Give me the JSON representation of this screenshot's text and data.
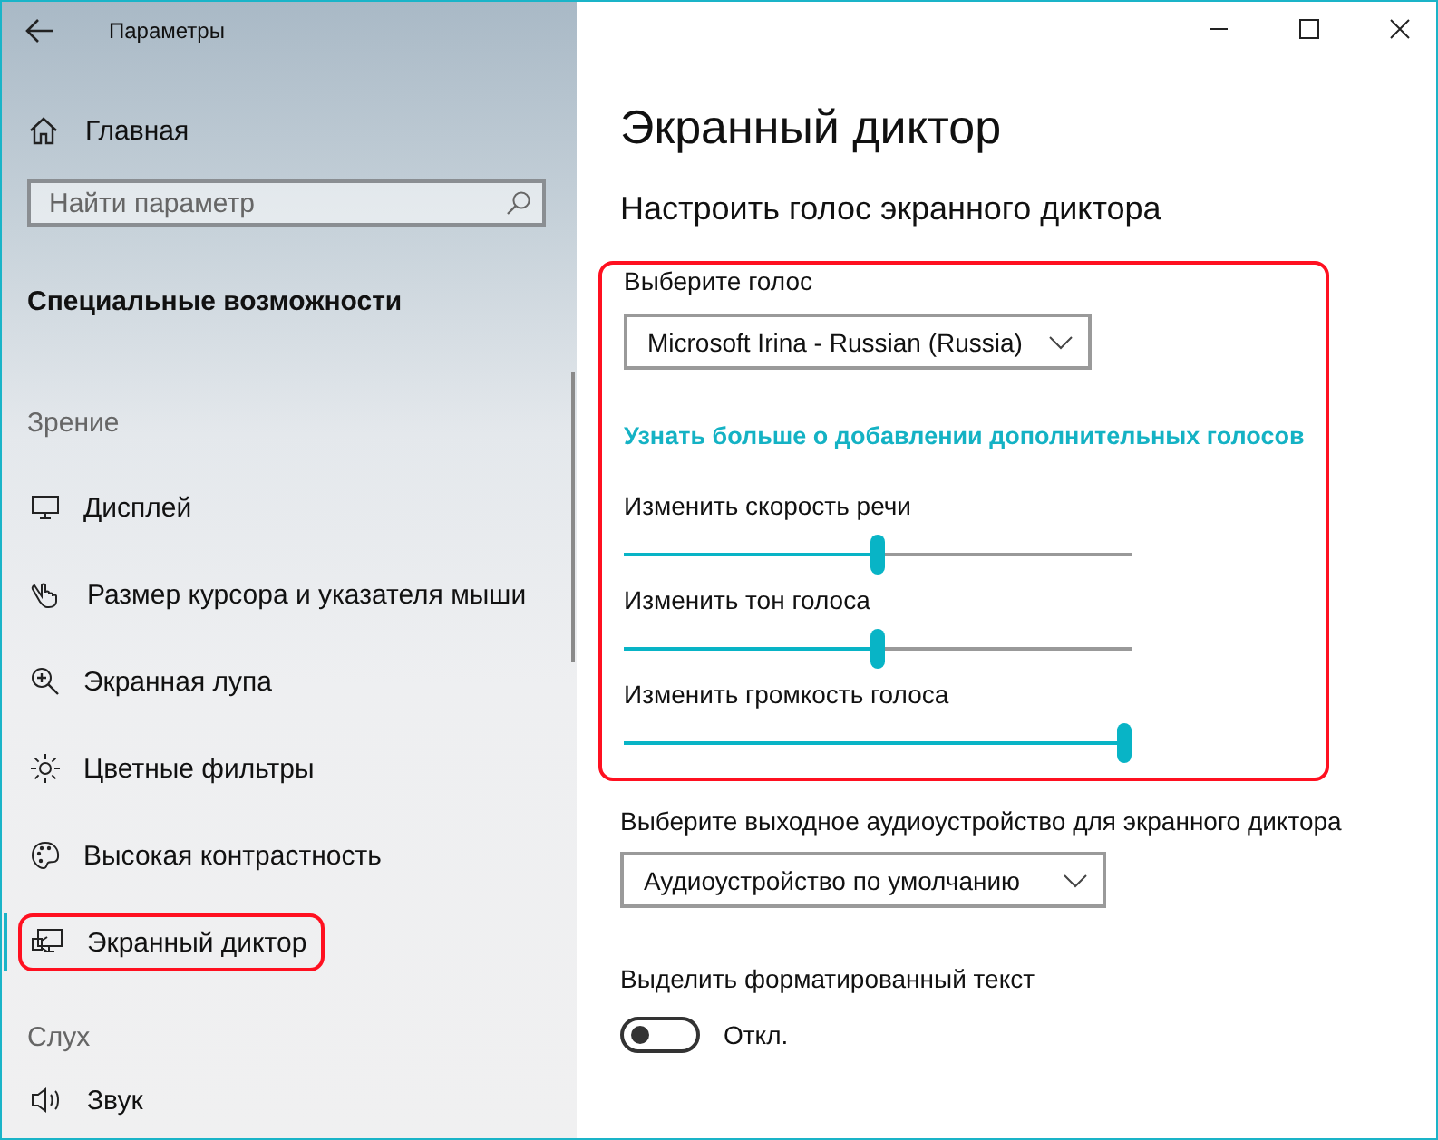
{
  "window": {
    "title": "Параметры"
  },
  "sidebar": {
    "home": "Главная",
    "search": {
      "placeholder": "Найти параметр"
    },
    "section_title": "Специальные возможности",
    "groups": [
      {
        "heading": "Зрение",
        "items": [
          {
            "label": "Дисплей",
            "selected": false,
            "annotated": false
          },
          {
            "label": "Размер курсора и указателя мыши",
            "selected": false,
            "annotated": false
          },
          {
            "label": "Экранная лупа",
            "selected": false,
            "annotated": false
          },
          {
            "label": "Цветные фильтры",
            "selected": false,
            "annotated": false
          },
          {
            "label": "Высокая контрастность",
            "selected": false,
            "annotated": false
          },
          {
            "label": "Экранный диктор",
            "selected": true,
            "annotated": true
          }
        ]
      },
      {
        "heading": "Слух",
        "items": [
          {
            "label": "Звук",
            "selected": false,
            "annotated": false
          }
        ]
      }
    ]
  },
  "content": {
    "title": "Экранный диктор",
    "subtitle": "Настроить голос экранного диктора",
    "voice_section": {
      "annotated": true,
      "label": "Выберите голос",
      "voice": "Microsoft Irina - Russian (Russia)",
      "link": "Узнать больше о добавлении дополнительных голосов",
      "sliders": [
        {
          "label": "Изменить скорость речи",
          "level": 0.5
        },
        {
          "label": "Изменить тон голоса",
          "level": 0.5
        },
        {
          "label": "Изменить громкость голоса",
          "level": 1.0
        }
      ]
    },
    "audio_label": "Выберите выходное аудиоустройство для экранного диктора",
    "audio_device": "Аудиоустройство по умолчанию",
    "format_label": "Выделить форматированный текст",
    "format_toggle": {
      "on": false,
      "state": "Откл."
    }
  }
}
